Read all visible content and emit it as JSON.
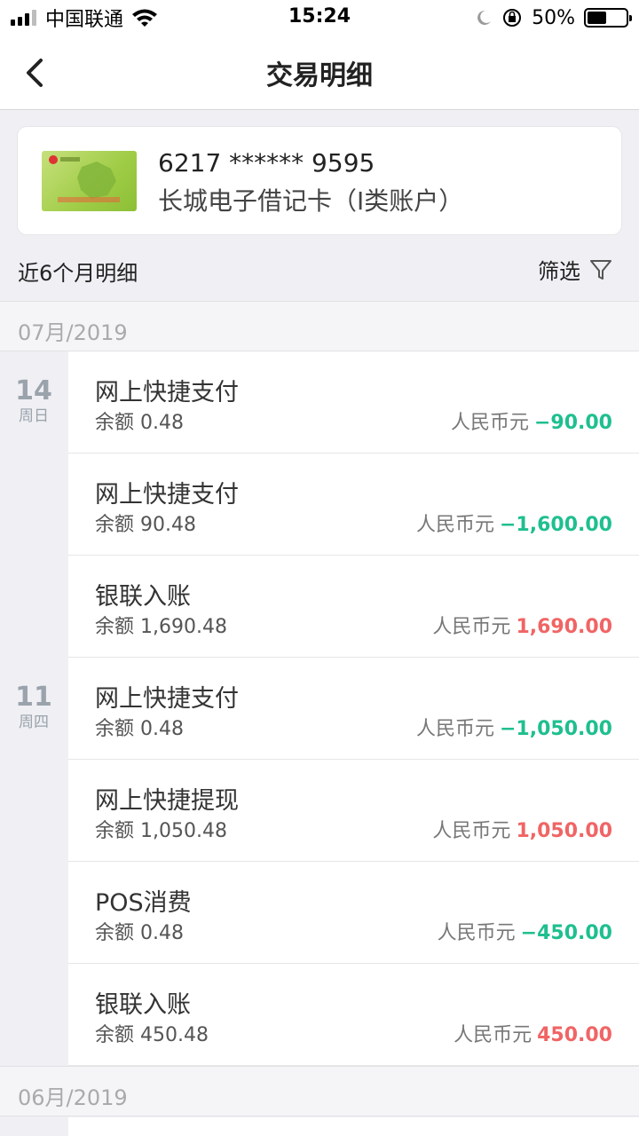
{
  "status_bar": {
    "carrier": "中国联通",
    "time": "15:24",
    "battery_percent": "50%",
    "battery_level": 0.5
  },
  "nav": {
    "title": "交易明细"
  },
  "card": {
    "number": "6217 ****** 9595",
    "name": "长城电子借记卡（I类账户）"
  },
  "period": {
    "label": "近6个月明细",
    "filter_label": "筛选"
  },
  "months": [
    {
      "label": "07月/2019",
      "days": [
        {
          "day": "14",
          "weekday": "周日",
          "transactions": [
            {
              "title": "网上快捷支付",
              "balance": "余额 0.48",
              "currency": "人民币元",
              "amount": "−90.00",
              "direction": "out"
            }
          ]
        },
        {
          "day": "11",
          "weekday": "周四",
          "transactions": [
            {
              "title": "网上快捷支付",
              "balance": "余额 90.48",
              "currency": "人民币元",
              "amount": "−1,600.00",
              "direction": "out"
            },
            {
              "title": "银联入账",
              "balance": "余额 1,690.48",
              "currency": "人民币元",
              "amount": "1,690.00",
              "direction": "in"
            },
            {
              "title": "网上快捷支付",
              "balance": "余额 0.48",
              "currency": "人民币元",
              "amount": "−1,050.00",
              "direction": "out"
            },
            {
              "title": "网上快捷提现",
              "balance": "余额 1,050.48",
              "currency": "人民币元",
              "amount": "1,050.00",
              "direction": "in"
            },
            {
              "title": "POS消费",
              "balance": "余额 0.48",
              "currency": "人民币元",
              "amount": "−450.00",
              "direction": "out"
            },
            {
              "title": "银联入账",
              "balance": "余额 450.48",
              "currency": "人民币元",
              "amount": "450.00",
              "direction": "in"
            }
          ]
        }
      ]
    },
    {
      "label": "06月/2019",
      "days": []
    }
  ],
  "colors": {
    "outgoing": "#1fbf8f",
    "incoming": "#f06565",
    "background": "#efeff4"
  },
  "icons": {
    "back": "chevron-left-icon",
    "filter": "funnel-icon",
    "wifi": "wifi-icon",
    "moon": "moon-icon",
    "lock": "rotation-lock-icon",
    "battery": "battery-icon"
  }
}
